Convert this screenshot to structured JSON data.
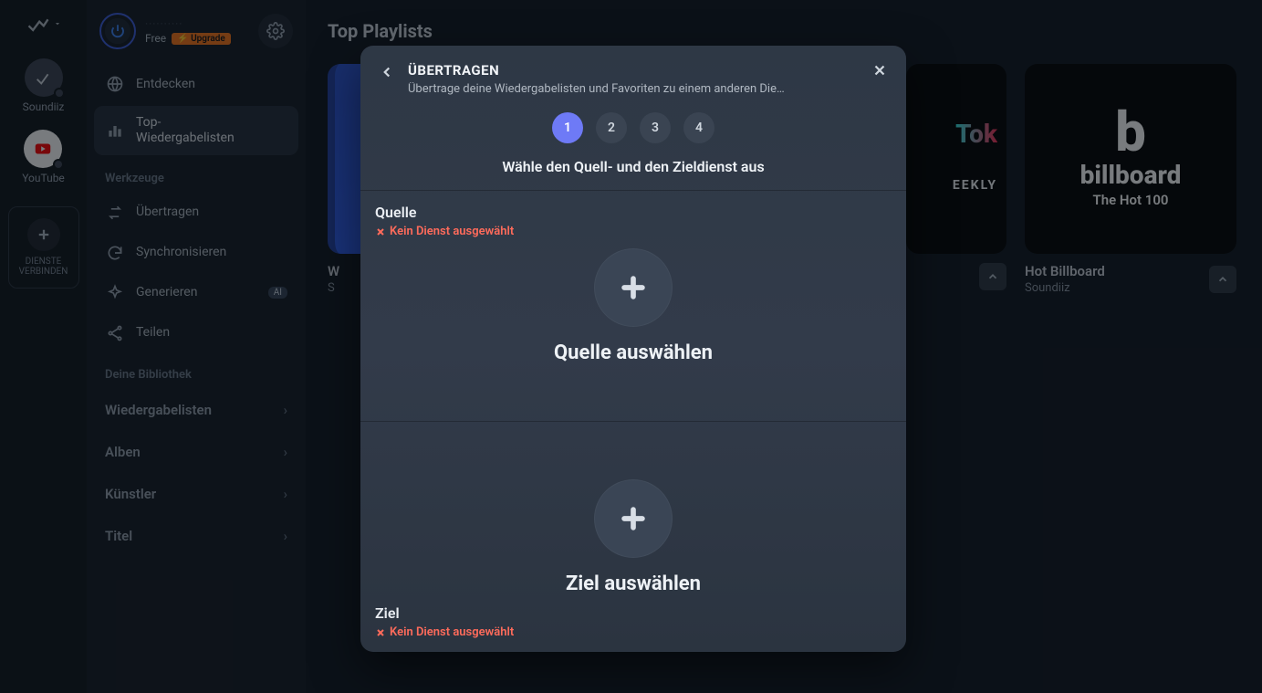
{
  "rail": {
    "items": [
      {
        "label": "Soundiiz"
      },
      {
        "label": "YouTube"
      }
    ],
    "add_label": "DIENSTE\nVERBINDEN"
  },
  "account": {
    "name_masked": "··········",
    "plan": "Free",
    "upgrade": "⚡ Upgrade"
  },
  "sidebar": {
    "discover_label": "Entdecken",
    "top_playlists_label": "Top-\nWiedergabelisten",
    "tools_header": "Werkzeuge",
    "tools": {
      "transfer": "Übertragen",
      "sync": "Synchronisieren",
      "generate": "Generieren",
      "generate_badge": "AI",
      "share": "Teilen"
    },
    "library_header": "Deine Bibliothek",
    "library": {
      "playlists": "Wiedergabelisten",
      "albums": "Alben",
      "artists": "Künstler",
      "tracks": "Titel"
    }
  },
  "main": {
    "page_title": "Top Playlists",
    "cards": [
      {
        "cover_line1": "W",
        "cover_line2": "S",
        "title": "",
        "sub": ""
      },
      {
        "cover_line1": "Tok",
        "cover_line2": "EEKLY",
        "title": "",
        "sub": ""
      },
      {
        "logo_b": "b",
        "logo_word": "billboard",
        "logo_sub": "The Hot 100",
        "title": "Hot Billboard",
        "sub": "Soundiiz"
      }
    ]
  },
  "modal": {
    "title": "ÜBERTRAGEN",
    "subtitle": "Übertrage deine Wiedergabelisten und Favoriten zu einem anderen Die…",
    "steps": [
      "1",
      "2",
      "3",
      "4"
    ],
    "active_step": 0,
    "instruction": "Wähle den Quell- und den Zieldienst aus",
    "source": {
      "label": "Quelle",
      "status": "Kein Dienst ausgewählt",
      "cta": "Quelle auswählen"
    },
    "destination": {
      "label": "Ziel",
      "status": "Kein Dienst ausgewählt",
      "cta": "Ziel auswählen"
    }
  }
}
